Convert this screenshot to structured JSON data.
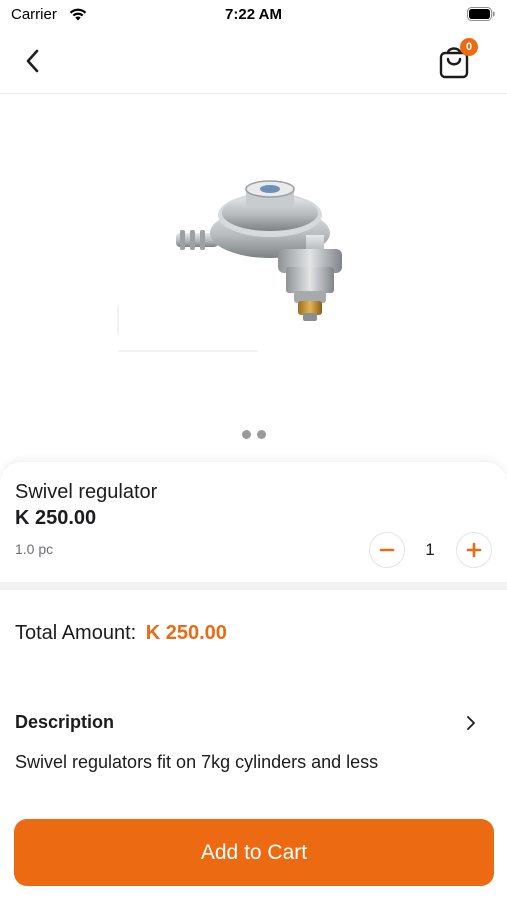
{
  "status_bar": {
    "carrier": "Carrier",
    "time": "7:22 AM"
  },
  "nav": {
    "back_icon": "chevron-left-icon",
    "cart_icon": "shopping-bag-icon",
    "cart_count": "0"
  },
  "product": {
    "image_icon": "gas-regulator-image",
    "carousel_dot_count": 2,
    "name": "Swivel regulator",
    "price": "K 250.00",
    "unit": "1.0 pc",
    "quantity": "1"
  },
  "total": {
    "label": "Total Amount:",
    "value": "K 250.00"
  },
  "description": {
    "title": "Description",
    "text": "Swivel regulators fit on 7kg cylinders and less"
  },
  "cta": {
    "label": "Add to Cart"
  },
  "colors": {
    "accent": "#ec6a12",
    "text": "#1c1c1e",
    "muted": "#6e6e73"
  }
}
